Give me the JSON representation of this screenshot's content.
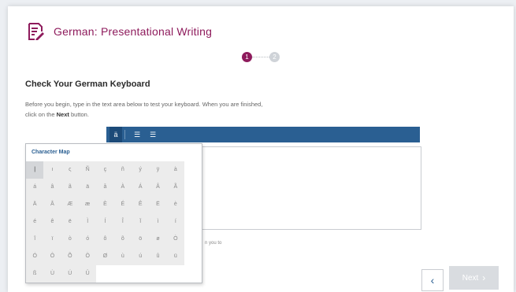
{
  "header": {
    "title": "German: Presentational Writing",
    "icon": "document-edit-icon"
  },
  "stepper": {
    "steps": [
      {
        "label": "1",
        "state": "active"
      },
      {
        "label": "2",
        "state": "inactive"
      }
    ]
  },
  "main": {
    "heading": "Check Your German Keyboard",
    "instructions_line1": "Before you begin, type in the text area below to test your keyboard. When you are finished,",
    "instructions_line2_prefix": "click on the",
    "instructions_next": "Next",
    "instructions_line2_suffix": "button.",
    "footnote": "n you to"
  },
  "toolbar": {
    "buttons": [
      {
        "name": "character-map-icon",
        "glyph": "ä"
      },
      {
        "name": "list-ordered-icon",
        "glyph": "☰"
      },
      {
        "name": "list-bullet-icon",
        "glyph": "☰"
      }
    ]
  },
  "charmap": {
    "title": "Character Map",
    "chars": [
      "|",
      "ı",
      "ς",
      "Ñ",
      "ç",
      "ñ",
      "ý",
      "ÿ",
      "à",
      "á",
      "â",
      "ã",
      "ä",
      "å",
      "À",
      "Á",
      "Â",
      "Ã",
      "Ä",
      "Å",
      "Æ",
      "æ",
      "È",
      "É",
      "Ê",
      "Ë",
      "è",
      "é",
      "ê",
      "ë",
      "Ì",
      "Í",
      "Î",
      "Ï",
      "ì",
      "í",
      "î",
      "ï",
      "ò",
      "ó",
      "ô",
      "õ",
      "ö",
      "ø",
      "Ò",
      "Ó",
      "Ô",
      "Õ",
      "Ö",
      "Ø",
      "ù",
      "ú",
      "û",
      "ü",
      "ß",
      "Ù",
      "Ú",
      "Û"
    ]
  },
  "nav": {
    "back_glyph": "‹",
    "next_label": "Next",
    "next_glyph": "›"
  },
  "colors": {
    "accent": "#8e1b5c",
    "toolbar": "#2a5f92",
    "disabled": "#d9dce0"
  }
}
